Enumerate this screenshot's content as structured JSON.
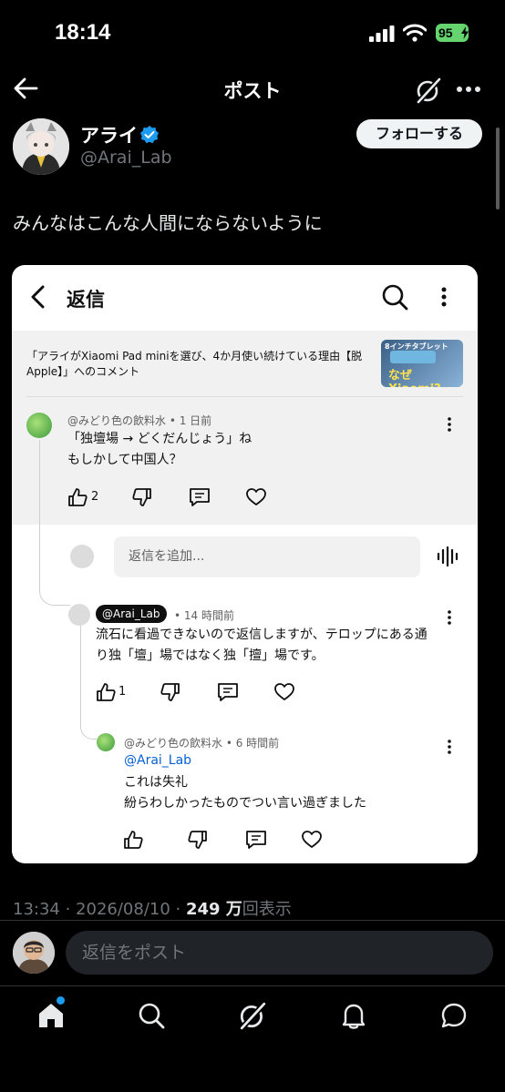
{
  "status_bar": {
    "time": "18:14",
    "battery": "95"
  },
  "header": {
    "title": "ポスト"
  },
  "author": {
    "name": "アライ",
    "handle": "@Arai_Lab",
    "follow_label": "フォローする"
  },
  "post": {
    "text": "みんなはこんな人間にならないように",
    "timestamp": "13:34 · 2026/08/10 · ",
    "views_number": "249 万",
    "views_suffix": "回表示"
  },
  "embedded": {
    "title": "返信",
    "video_text": "「アライがXiaomi Pad miniを選び、4か月使い続けている理由【脱Apple】」へのコメント",
    "thumb_top": "8インチタブレット",
    "thumb_big": "なぜXiaomi?",
    "add_reply_placeholder": "返信を追加...",
    "comments": [
      {
        "author": "@みどり色の飲料水",
        "time": "1 日前",
        "line1": "「独壇場 → どくだんじょう」ね",
        "line2": "もしかして中国人？",
        "likes": "2"
      },
      {
        "author": "@Arai_Lab",
        "time": "14 時間前",
        "line1": "流石に看過できないので返信しますが、テロップにある通",
        "line2": "り独「壇」場ではなく独「擅」場です。",
        "likes": "1"
      },
      {
        "author": "@みどり色の飲料水",
        "time": "6 時間前",
        "mention": "@Arai_Lab",
        "line1": "これは失礼",
        "line2": "紛らわしかったものでつい言い過ぎました",
        "likes": ""
      }
    ]
  },
  "composer": {
    "placeholder": "返信をポスト"
  },
  "colors": {
    "background": "#000000",
    "accent": "#1d9bf0",
    "battery": "#65d46e",
    "card": "#ffffff",
    "verified": "#1d9bf0"
  }
}
